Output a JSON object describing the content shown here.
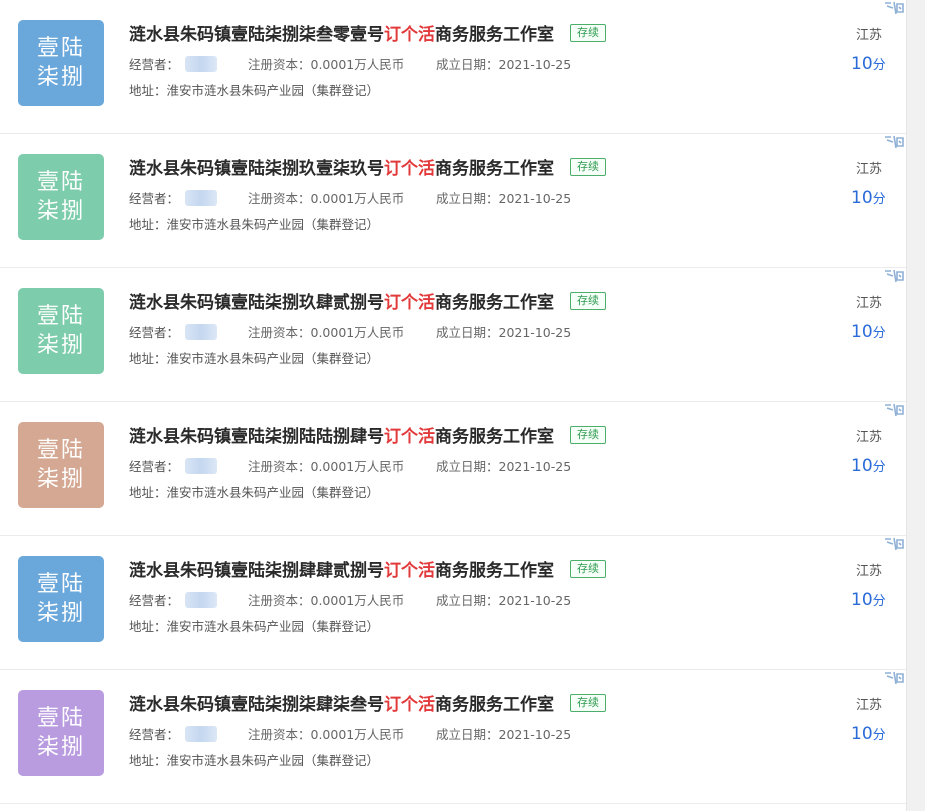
{
  "list": {
    "items": [
      {
        "avatar_line1": "壹陆",
        "avatar_line2": "柒捌",
        "avatar_color": "#6aa7db",
        "title_prefix": "涟水县朱码镇壹陆柒捌柒叁零壹号",
        "title_hl": "订个活",
        "title_suffix": "商务服务工作室",
        "tag": "存续",
        "operator_label": "经营者：",
        "capital": "注册资本：0.0001万人民币",
        "date": "成立日期：2021-10-25",
        "address": "地址：淮安市涟水县朱码产业园（集群登记）",
        "province": "江苏",
        "score": "10",
        "score_unit": "分"
      },
      {
        "avatar_line1": "壹陆",
        "avatar_line2": "柒捌",
        "avatar_color": "#7dccab",
        "title_prefix": "涟水县朱码镇壹陆柒捌玖壹柒玖号",
        "title_hl": "订个活",
        "title_suffix": "商务服务工作室",
        "tag": "存续",
        "operator_label": "经营者：",
        "capital": "注册资本：0.0001万人民币",
        "date": "成立日期：2021-10-25",
        "address": "地址：淮安市涟水县朱码产业园（集群登记）",
        "province": "江苏",
        "score": "10",
        "score_unit": "分"
      },
      {
        "avatar_line1": "壹陆",
        "avatar_line2": "柒捌",
        "avatar_color": "#7dccab",
        "title_prefix": "涟水县朱码镇壹陆柒捌玖肆贰捌号",
        "title_hl": "订个活",
        "title_suffix": "商务服务工作室",
        "tag": "存续",
        "operator_label": "经营者：",
        "capital": "注册资本：0.0001万人民币",
        "date": "成立日期：2021-10-25",
        "address": "地址：淮安市涟水县朱码产业园（集群登记）",
        "province": "江苏",
        "score": "10",
        "score_unit": "分"
      },
      {
        "avatar_line1": "壹陆",
        "avatar_line2": "柒捌",
        "avatar_color": "#d4a893",
        "title_prefix": "涟水县朱码镇壹陆柒捌陆陆捌肆号",
        "title_hl": "订个活",
        "title_suffix": "商务服务工作室",
        "tag": "存续",
        "operator_label": "经营者：",
        "capital": "注册资本：0.0001万人民币",
        "date": "成立日期：2021-10-25",
        "address": "地址：淮安市涟水县朱码产业园（集群登记）",
        "province": "江苏",
        "score": "10",
        "score_unit": "分"
      },
      {
        "avatar_line1": "壹陆",
        "avatar_line2": "柒捌",
        "avatar_color": "#6aa7db",
        "title_prefix": "涟水县朱码镇壹陆柒捌肆肆贰捌号",
        "title_hl": "订个活",
        "title_suffix": "商务服务工作室",
        "tag": "存续",
        "operator_label": "经营者：",
        "capital": "注册资本：0.0001万人民币",
        "date": "成立日期：2021-10-25",
        "address": "地址：淮安市涟水县朱码产业园（集群登记）",
        "province": "江苏",
        "score": "10",
        "score_unit": "分"
      },
      {
        "avatar_line1": "壹陆",
        "avatar_line2": "柒捌",
        "avatar_color": "#b99be0",
        "title_prefix": "涟水县朱码镇壹陆柒捌柒肆柒叁号",
        "title_hl": "订个活",
        "title_suffix": "商务服务工作室",
        "tag": "存续",
        "operator_label": "经营者：",
        "capital": "注册资本：0.0001万人民币",
        "date": "成立日期：2021-10-25",
        "address": "地址：淮安市涟水县朱码产业园（集群登记）",
        "province": "江苏",
        "score": "10",
        "score_unit": "分"
      }
    ]
  }
}
